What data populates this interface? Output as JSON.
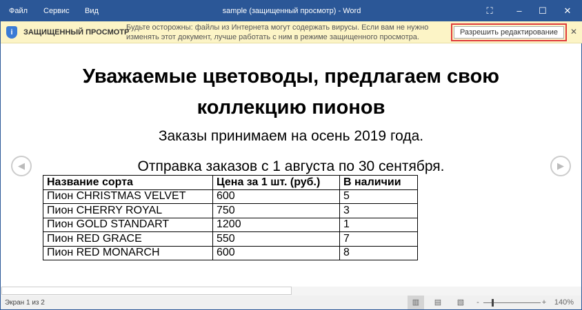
{
  "titlebar": {
    "menu": [
      "Файл",
      "Сервис",
      "Вид"
    ],
    "title": "sample (защищенный просмотр) - Word",
    "controls": {
      "fullscreen": "⛶",
      "minimize": "–",
      "maximize": "☐",
      "close": "✕"
    }
  },
  "infobar": {
    "icon": "i",
    "title": "ЗАЩИЩЕННЫЙ ПРОСМОТР",
    "message": "Будьте осторожны: файлы из Интернета могут содержать вирусы. Если вам не нужно изменять этот документ, лучше работать с ним в режиме защищенного просмотра.",
    "button": "Разрешить редактирование",
    "close": "✕"
  },
  "document": {
    "heading_line1": "Уважаемые цветоводы, предлагаем свою",
    "heading_line2": "коллекцию пионов",
    "line1": "Заказы принимаем на осень 2019 года.",
    "line2": "Отправка  заказов с 1 августа  по 30 сентября.",
    "prev": "◀",
    "next": "▶",
    "table": {
      "headers": [
        "Название сорта",
        "Цена за 1 шт. (руб.)",
        "В наличии"
      ],
      "rows": [
        [
          "Пион CHRISTMAS VELVET",
          "600",
          "5"
        ],
        [
          "Пион CHERRY ROYAL",
          "750",
          "3"
        ],
        [
          "Пион GOLD STANDART",
          "1200",
          "1"
        ],
        [
          "Пион RED GRACE",
          "550",
          "7"
        ],
        [
          "Пион RED MONARCH",
          "600",
          "8"
        ]
      ]
    }
  },
  "status": {
    "page": "Экран 1 из 2",
    "zoom_minus": "-",
    "zoom_plus": "+",
    "zoom": "140%",
    "zoom_percent": 140
  }
}
